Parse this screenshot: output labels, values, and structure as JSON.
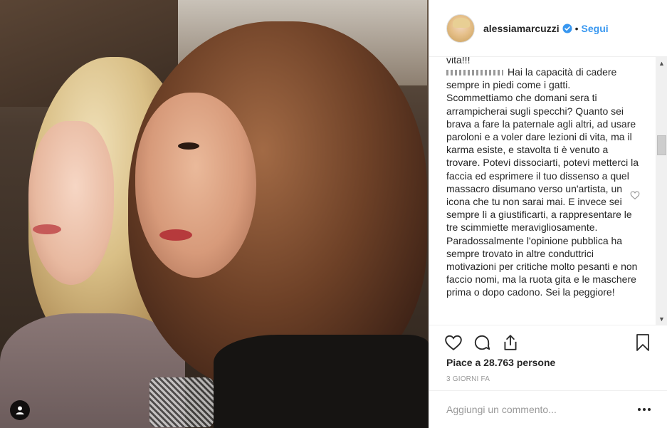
{
  "post": {
    "author": "alessiamarcuzzi",
    "verified": true,
    "separator": "•",
    "follow_label": "Segui"
  },
  "comment": {
    "partial_previous": "vita!!!",
    "text": "Hai la capacità di cadere sempre in piedi come i gatti. Scommettiamo che domani sera ti arrampicherai sugli specchi? Quanto sei brava a fare la paternale agli altri, ad usare paroloni e a voler dare lezioni di vita, ma il karma esiste, e stavolta ti è venuto a trovare. Potevi dissociarti, potevi metterci la faccia ed esprimere il tuo dissenso a quel massacro disumano verso un'artista, un icona che tu non sarai mai. E invece sei sempre lì a giustificarti, a rappresentare le tre scimmiette meravigliosamente. Paradossalmente l'opinione pubblica ha sempre trovato in altre conduttrici motivazioni per critiche molto pesanti e non faccio nomi, ma la ruota gita e le maschere prima o dopo cadono. Sei la peggiore!"
  },
  "stats": {
    "likes_label": "Piace a 28.763 persone",
    "time_ago": "3 GIORNI FA"
  },
  "composer": {
    "placeholder": "Aggiungi un commento..."
  },
  "icons": {
    "like": "heart-icon",
    "comment": "comment-bubble-icon",
    "share": "share-icon",
    "save": "bookmark-icon",
    "more": "more-dots-icon",
    "user_tag": "user-tag-icon",
    "verified": "verified-badge-icon"
  },
  "colors": {
    "accent": "#3897f0",
    "text": "#262626",
    "muted": "#999999"
  }
}
